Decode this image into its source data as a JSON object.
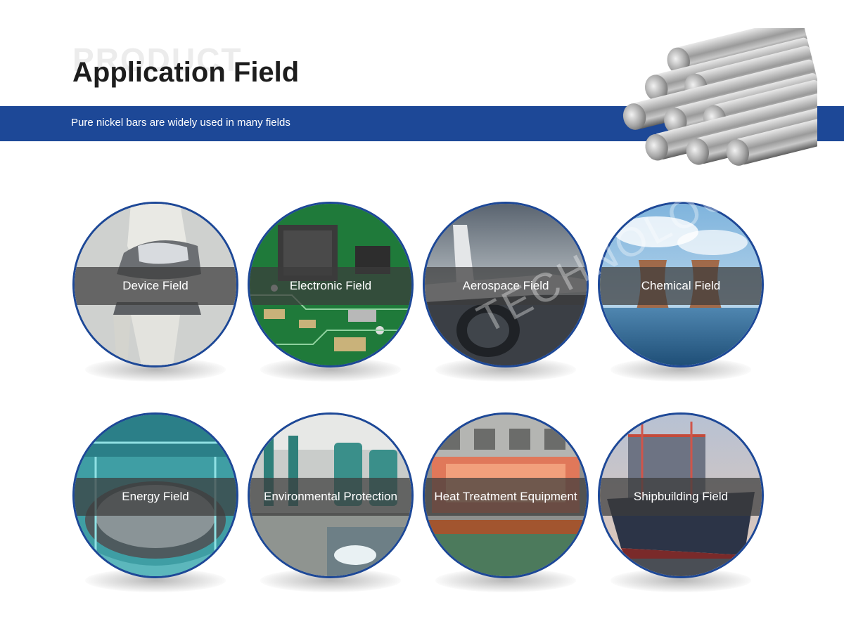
{
  "header": {
    "ghost_text": "PRODUCT",
    "title": "Application Field",
    "subtitle": "Pure nickel bars are widely used in many fields"
  },
  "colors": {
    "brand_blue": "#1d4897",
    "label_band": "#3c3c3c"
  },
  "watermark": "TECHNOLOG",
  "fields": [
    {
      "label": "Device Field",
      "icon": "knee-implant-icon"
    },
    {
      "label": "Electronic Field",
      "icon": "circuit-board-icon"
    },
    {
      "label": "Aerospace Field",
      "icon": "airplane-icon"
    },
    {
      "label": "Chemical Field",
      "icon": "cooling-tower-icon"
    },
    {
      "label": "Energy Field",
      "icon": "reactor-core-icon"
    },
    {
      "label": "Environmental Protection",
      "icon": "water-treatment-icon"
    },
    {
      "label": "Heat Treatment Equipment",
      "icon": "furnace-icon"
    },
    {
      "label": "Shipbuilding Field",
      "icon": "cargo-ship-icon"
    }
  ]
}
